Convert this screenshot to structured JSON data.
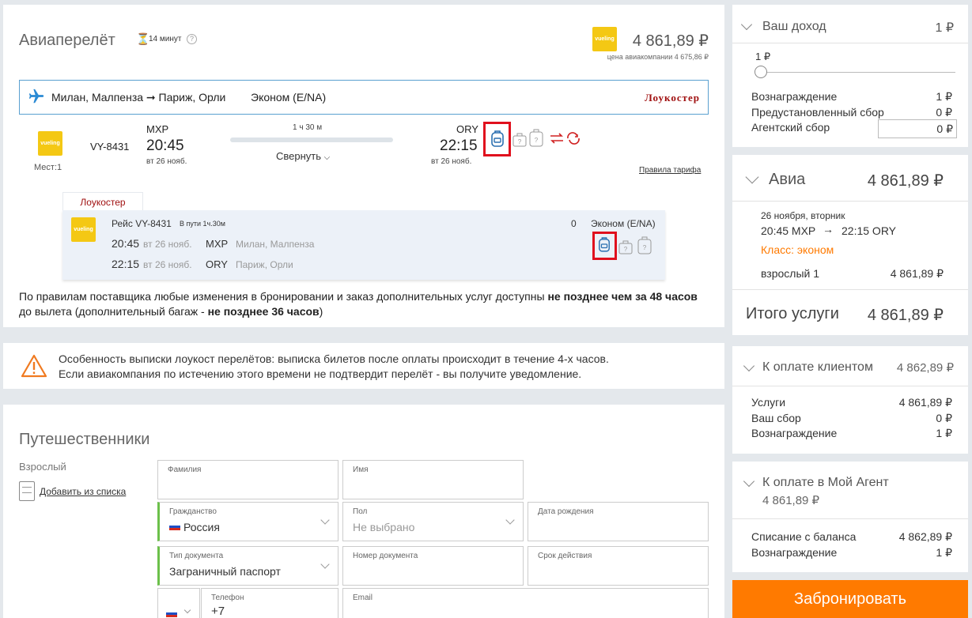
{
  "flight": {
    "title": "Авиаперелёт",
    "timer": "14 минут",
    "airline_logo": "vueling",
    "price": "4 861,89 ₽",
    "airline_price": "цена авиакомпании 4 675,86 ₽",
    "route": "Милан, Малпенза ➞ Париж, Орли",
    "class": "Эконом (E/NA)",
    "lowcoster": "Лоукостер",
    "seats": "Мест:1",
    "flight_no": "VY-8431",
    "dep_code": "MXP",
    "dep_time": "20:45",
    "dep_date": "вт 26 нояб.",
    "duration": "1 ч 30 м",
    "collapse": "Свернуть",
    "arr_code": "ORY",
    "arr_time": "22:15",
    "arr_date": "вт 26 нояб.",
    "tariff_rules": "Правила тарифа",
    "seg_tab": "Лоукостер",
    "seg_flight": "Рейс VY-8431",
    "seg_duration": "В пути 1ч.30м",
    "seg_count": "0",
    "seg_class": "Эконом (E/NA)",
    "seg_dep_time": "20:45",
    "seg_dep_date": "вт 26 нояб.",
    "seg_dep_code": "MXP",
    "seg_dep_city": "Милан, Малпенза",
    "seg_arr_time": "22:15",
    "seg_arr_date": "вт 26 нояб.",
    "seg_arr_code": "ORY",
    "seg_arr_city": "Париж, Орли",
    "notice_1": "По правилам поставщика любые изменения в бронировании и заказ дополнительных услуг доступны ",
    "notice_b1": "не позднее чем за 48 часов",
    "notice_2": " до вылета (дополнительный багаж - ",
    "notice_b2": "не позднее 36 часов",
    "notice_3": ")"
  },
  "warning": {
    "line1": "Особенность выписки лоукост перелётов: выписка билетов после оплаты происходит в течение 4-х часов.",
    "line2": "Если авиакомпания по истечению этого времени не подтвердит перелёт - вы получите уведомление."
  },
  "travelers": {
    "title": "Путешественники",
    "type": "Взрослый",
    "add_from_list": "Добавить из списка",
    "surname_label": "Фамилия",
    "name_label": "Имя",
    "citizenship_label": "Гражданство",
    "citizenship_value": "Россия",
    "gender_label": "Пол",
    "gender_value": "Не выбрано",
    "birth_label": "Дата рождения",
    "doc_type_label": "Тип документа",
    "doc_type_value": "Заграничный паспорт",
    "doc_no_label": "Номер документа",
    "expiry_label": "Срок действия",
    "phone_label": "Телефон",
    "phone_value": "+7",
    "email_label": "Email"
  },
  "income": {
    "title": "Ваш доход",
    "value": "1 ₽",
    "slider_value": "1 ₽",
    "reward_label": "Вознаграждение",
    "reward_value": "1 ₽",
    "preset_fee_label": "Предустановленный сбор",
    "preset_fee_value": "0 ₽",
    "agent_fee_label": "Агентский сбор",
    "agent_fee_value": "0 ₽"
  },
  "avia": {
    "title": "Авиа",
    "total": "4 861,89 ₽",
    "date": "26 ноября, вторник",
    "route_from": "20:45 MXP",
    "route_to": "22:15 ORY",
    "class": "Класс: эконом",
    "pax_label": "взрослый 1",
    "pax_value": "4 861,89 ₽",
    "services_label": "Итого услуги",
    "services_value": "4 861,89 ₽"
  },
  "client_pay": {
    "title": "К оплате клиентом",
    "value": "4 862,89 ₽",
    "services_label": "Услуги",
    "services_value": "4 861,89 ₽",
    "fee_label": "Ваш сбор",
    "fee_value": "0 ₽",
    "reward_label": "Вознаграждение",
    "reward_value": "1 ₽"
  },
  "agent_pay": {
    "title": "К оплате в Мой Агент",
    "value": "4 861,89 ₽",
    "balance_label": "Списание с баланса",
    "balance_value": "4 862,89 ₽",
    "reward_label": "Вознаграждение",
    "reward_value": "1 ₽"
  },
  "book_button": "Забронировать",
  "colors": {
    "accent_orange": "#ff7a00",
    "highlight_red": "#e0101d",
    "plane_blue": "#2a8ad4"
  }
}
